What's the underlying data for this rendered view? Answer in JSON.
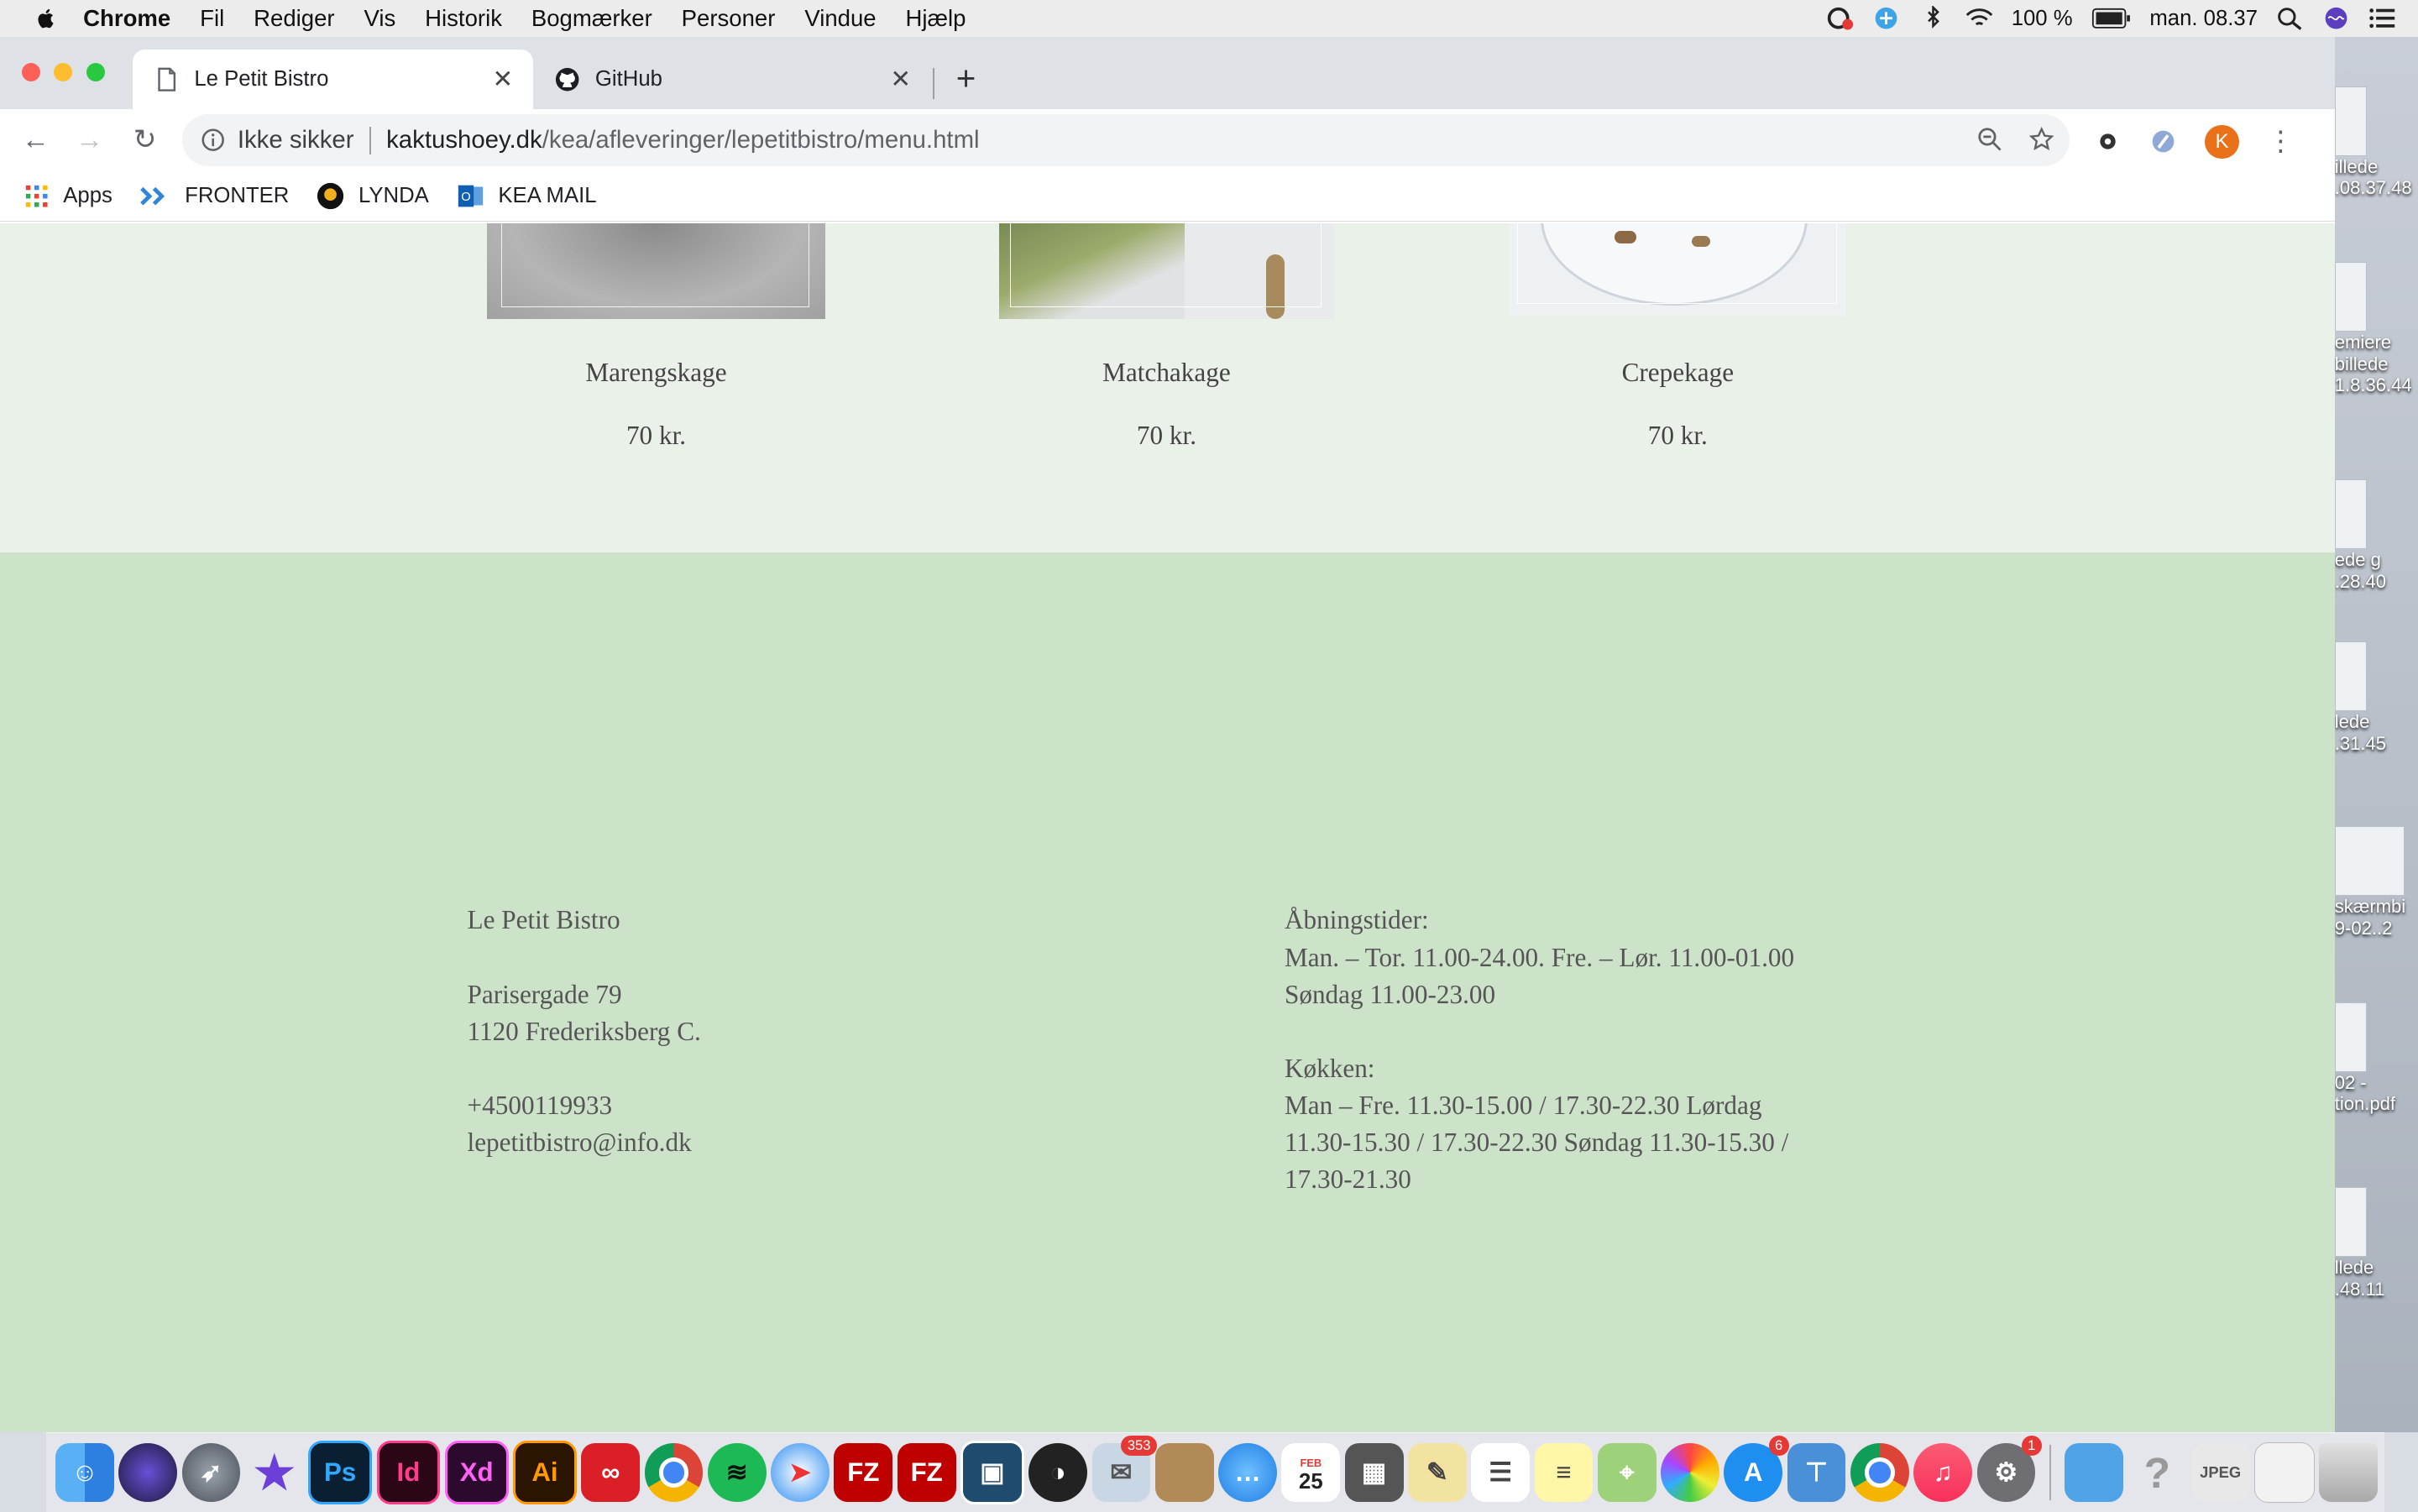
{
  "menubar": {
    "app": "Chrome",
    "items": [
      "Fil",
      "Rediger",
      "Vis",
      "Historik",
      "Bogmærker",
      "Personer",
      "Vindue",
      "Hjælp"
    ],
    "battery": "100 %",
    "clock": "man. 08.37"
  },
  "browser": {
    "tabs": [
      {
        "title": "Le Petit Bistro",
        "active": true
      },
      {
        "title": "GitHub",
        "active": false
      }
    ],
    "security_label": "Ikke sikker",
    "url_host": "kaktushoey.dk",
    "url_path": "/kea/afleveringer/lepetitbistro/menu.html",
    "profile_initial": "K",
    "bookmarks": [
      {
        "label": "Apps",
        "icon": "apps-grid-icon"
      },
      {
        "label": "FRONTER",
        "icon": "fronter-icon"
      },
      {
        "label": "LYNDA",
        "icon": "lynda-icon"
      },
      {
        "label": "KEA MAIL",
        "icon": "outlook-icon"
      }
    ]
  },
  "menu_items": [
    {
      "name": "Marengskage",
      "price": "70 kr."
    },
    {
      "name": "Matchakage",
      "price": "70 kr."
    },
    {
      "name": "Crepekage",
      "price": "70 kr."
    }
  ],
  "footer": {
    "name": "Le Petit Bistro",
    "street": "Parisergade 79",
    "city": "1120 Frederiksberg C.",
    "phone": "+4500119933",
    "email": "lepetitbistro@info.dk",
    "hours_title": "Åbningstider:",
    "hours_line1": "Man. – Tor. 11.00-24.00. Fre. – Lør. 11.00-01.00",
    "hours_line2": "Søndag 11.00-23.00",
    "kitchen_title": "Køkken:",
    "kitchen_line1": "Man – Fre. 11.30-15.00 / 17.30-22.30 Lørdag",
    "kitchen_line2": "11.30-15.30 / 17.30-22.30 Søndag 11.30-15.30 /",
    "kitchen_line3": "17.30-21.30"
  },
  "desktop_labels": [
    "illede",
    ".08.37.48",
    "emiere",
    "billede",
    "1.8.36.44",
    "ede g",
    ".28.40",
    "lede",
    ".31.45",
    "skærmbi",
    "9-02..2",
    "02 -",
    "tion.pdf",
    "llede",
    ".48.11"
  ],
  "dock": {
    "badges": {
      "mail": "353",
      "calendar_day": "25",
      "calendar_month": "FEB",
      "appstore": "6",
      "prefs": "1"
    }
  },
  "colors": {
    "menu_band": "#eaf1e8",
    "footer_bg": "#cce2c9",
    "text": "#555555",
    "profile": "#e8711a"
  }
}
